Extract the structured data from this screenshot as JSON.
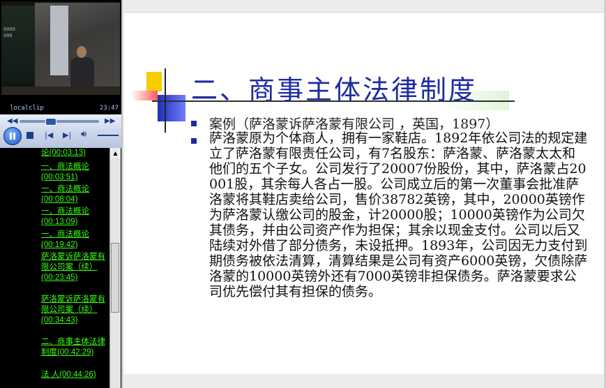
{
  "player": {
    "clip_name": "localclip",
    "clip_time": "23:47",
    "seek_fraction": 0.39,
    "controls": {
      "rewind": "rewind-icon",
      "fast_forward": "fast-forward-icon",
      "play_pause": "pause-icon",
      "stop": "stop-icon",
      "previous": "previous-track-icon",
      "next": "next-track-icon",
      "volume": "volume-icon"
    }
  },
  "playlist": {
    "items": [
      {
        "label": "论(00:03:13)"
      },
      {
        "label": "一、商法概论(00:03:51)"
      },
      {
        "label": "一、商法概论(00:08:04)"
      },
      {
        "label": "一、商法概论(00:13:09)"
      },
      {
        "label": "一、商法概论(00:19:42)"
      },
      {
        "label": "萨洛蒙诉萨洛蒙有限公司案（续）(00:23:45)"
      },
      {
        "label": "萨洛蒙诉萨洛蒙有限公司案（续）(00:34:43)"
      },
      {
        "label": "二、商事主体法律制度(00:42:29)"
      },
      {
        "label": "法 人(00:44:26)"
      }
    ]
  },
  "slide": {
    "title": "二、商事主体法律制度",
    "case_line": "案例（萨洛蒙诉萨洛蒙有限公司 ，英国，1897）",
    "body": "萨洛蒙原为个体商人，拥有一家鞋店。1892年依公司法的规定建立了萨洛蒙有限责任公司，有7名股东：萨洛蒙、萨洛蒙太太和他们的五个子女。公司发行了20007份股份，其中，萨洛蒙占20001股，其余每人各占一股。公司成立后的第一次董事会批准萨洛蒙将其鞋店卖给公司，售价38782英镑，其中，20000英镑作为萨洛蒙认缴公司的股金，计20000股；10000英镑作为公司欠其债务，并由公司资产作为担保；其余以现金支付。公司以后又陆续对外借了部分债务，未设抵押。1893年，公司因无力支付到期债务被依法清算，清算结果是公司有资产6000英镑，欠债除萨洛蒙的10000英镑外还有7000英镑非担保债务。萨洛蒙要求公司优先偿付其有担保的债务。",
    "colors": {
      "title": "#1c2ba0",
      "link_green": "#39ff14",
      "deco_yellow": "#f7cc00",
      "deco_blue": "#1e2fb8"
    }
  }
}
